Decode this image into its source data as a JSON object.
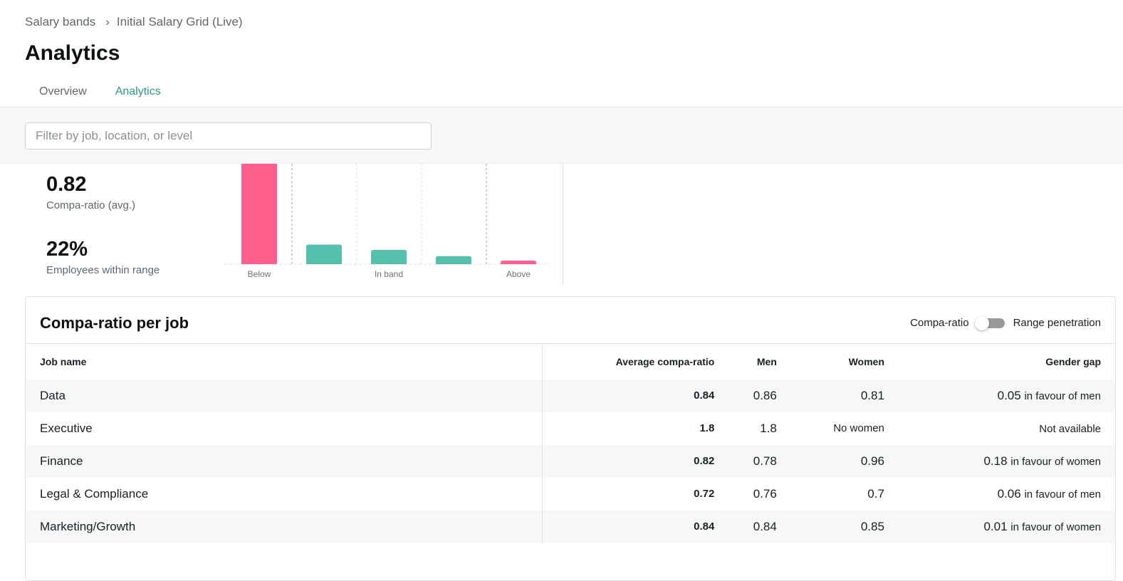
{
  "breadcrumb": {
    "parent": "Salary bands",
    "separator": "›",
    "current": "Initial Salary Grid (Live)"
  },
  "page_title": "Analytics",
  "tabs": [
    {
      "label": "Overview",
      "active": false
    },
    {
      "label": "Analytics",
      "active": true
    }
  ],
  "filter": {
    "placeholder": "Filter by job, location, or level",
    "value": ""
  },
  "kpis": [
    {
      "value": "0.82",
      "label": "Compa-ratio (avg.)"
    },
    {
      "value": "22%",
      "label": "Employees within range"
    }
  ],
  "chart_data": {
    "type": "bar",
    "categories": [
      "Below",
      "",
      "In band",
      "",
      "Above"
    ],
    "tick_labels": [
      "Below",
      "In band",
      "Above"
    ],
    "values": [
      60,
      11,
      8,
      4.5,
      2
    ],
    "colors": [
      "#ff5f8c",
      "#54c0ad",
      "#54c0ad",
      "#54c0ad",
      "#ff5f8c"
    ],
    "ylim": [
      0,
      60
    ],
    "grid": true,
    "title": "",
    "xlabel": "",
    "ylabel": ""
  },
  "table": {
    "title": "Compa-ratio per job",
    "toggle": {
      "left_label": "Compa-ratio",
      "right_label": "Range penetration",
      "on": false
    },
    "columns": [
      "Job name",
      "Average compa-ratio",
      "Men",
      "Women",
      "Gender gap"
    ],
    "rows": [
      {
        "job": "Data",
        "avg": "0.84",
        "men": "0.86",
        "women": "0.81",
        "gap": "0.05",
        "gap_text": "in favour of men"
      },
      {
        "job": "Executive",
        "avg": "1.8",
        "men": "1.8",
        "women": "No women",
        "gap": "",
        "gap_text": "Not available"
      },
      {
        "job": "Finance",
        "avg": "0.82",
        "men": "0.78",
        "women": "0.96",
        "gap": "0.18",
        "gap_text": "in favour of women"
      },
      {
        "job": "Legal & Compliance",
        "avg": "0.72",
        "men": "0.76",
        "women": "0.7",
        "gap": "0.06",
        "gap_text": "in favour of men"
      },
      {
        "job": "Marketing/Growth",
        "avg": "0.84",
        "men": "0.84",
        "women": "0.85",
        "gap": "0.01",
        "gap_text": "in favour of women"
      }
    ]
  }
}
